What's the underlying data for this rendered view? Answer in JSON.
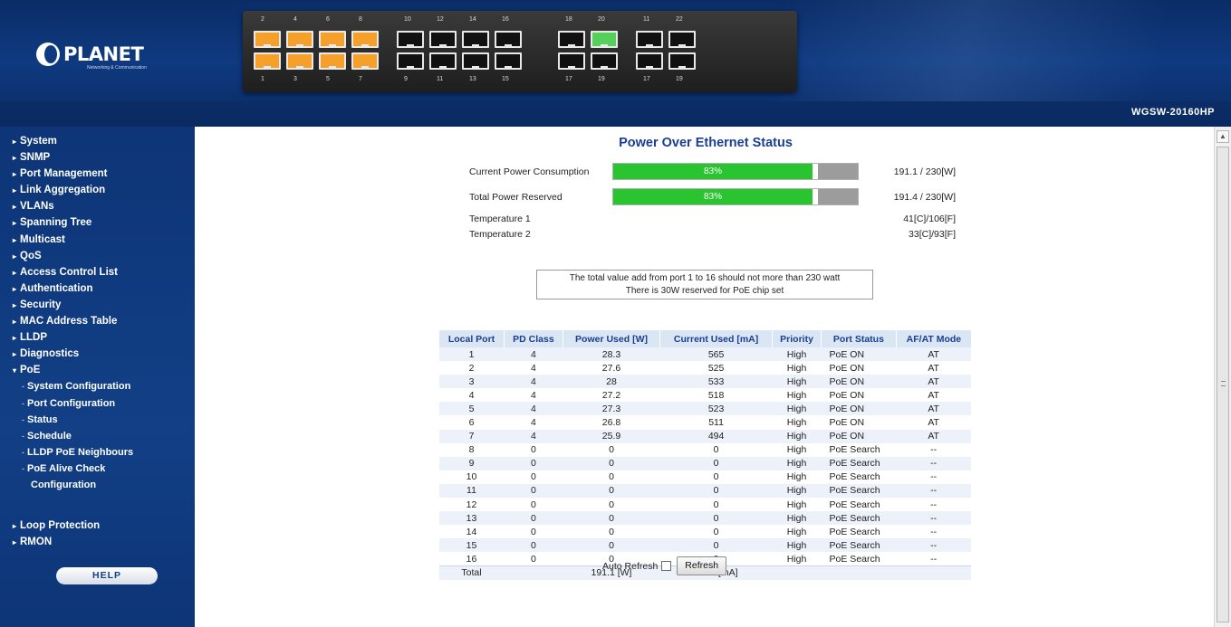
{
  "header": {
    "logo_text": "PLANET",
    "logo_subtext": "Networking & Communication",
    "model": "WGSW-20160HP"
  },
  "device": {
    "top_ports": [
      "2",
      "4",
      "6",
      "8",
      "10",
      "12",
      "14",
      "16",
      "18",
      "20",
      "11",
      "22"
    ],
    "bottom_ports": [
      "1",
      "3",
      "5",
      "7",
      "9",
      "11",
      "13",
      "15",
      "17",
      "19",
      "17",
      "19"
    ]
  },
  "sidebar": {
    "items": [
      {
        "label": "System"
      },
      {
        "label": "SNMP"
      },
      {
        "label": "Port Management"
      },
      {
        "label": "Link Aggregation"
      },
      {
        "label": "VLANs"
      },
      {
        "label": "Spanning Tree"
      },
      {
        "label": "Multicast"
      },
      {
        "label": "QoS"
      },
      {
        "label": "Access Control List"
      },
      {
        "label": "Authentication"
      },
      {
        "label": "Security"
      },
      {
        "label": "MAC Address Table"
      },
      {
        "label": "LLDP"
      },
      {
        "label": "Diagnostics"
      },
      {
        "label": "PoE"
      }
    ],
    "poe_sub": [
      {
        "label": "System Configuration"
      },
      {
        "label": "Port Configuration"
      },
      {
        "label": "Status"
      },
      {
        "label": "Schedule"
      },
      {
        "label": "LLDP PoE Neighbours"
      },
      {
        "label": "PoE Alive Check"
      }
    ],
    "poe_sub_cont": "Configuration",
    "lower_items": [
      {
        "label": "Loop Protection"
      },
      {
        "label": "RMON"
      }
    ],
    "help_label": "HELP"
  },
  "main": {
    "title": "Power Over Ethernet Status",
    "current_power": {
      "label": "Current Power Consumption",
      "percent_text": "83%",
      "fraction": 0.83,
      "value": "191.1 / 230[W]"
    },
    "total_reserved": {
      "label": "Total Power Reserved",
      "percent_text": "83%",
      "fraction": 0.83,
      "value": "191.4 / 230[W]"
    },
    "temp1": {
      "label": "Temperature 1",
      "value": "41[C]/106[F]"
    },
    "temp2": {
      "label": "Temperature 2",
      "value": "33[C]/93[F]"
    },
    "note_line1": "The total value add from port 1 to 16 should not more than 230 watt",
    "note_line2": "There is 30W reserved for PoE chip set",
    "table": {
      "headers": [
        "Local Port",
        "PD Class",
        "Power Used [W]",
        "Current Used [mA]",
        "Priority",
        "Port Status",
        "AF/AT Mode"
      ],
      "rows": [
        [
          "1",
          "4",
          "28.3",
          "565",
          "High",
          "PoE ON",
          "AT"
        ],
        [
          "2",
          "4",
          "27.6",
          "525",
          "High",
          "PoE ON",
          "AT"
        ],
        [
          "3",
          "4",
          "28",
          "533",
          "High",
          "PoE ON",
          "AT"
        ],
        [
          "4",
          "4",
          "27.2",
          "518",
          "High",
          "PoE ON",
          "AT"
        ],
        [
          "5",
          "4",
          "27.3",
          "523",
          "High",
          "PoE ON",
          "AT"
        ],
        [
          "6",
          "4",
          "26.8",
          "511",
          "High",
          "PoE ON",
          "AT"
        ],
        [
          "7",
          "4",
          "25.9",
          "494",
          "High",
          "PoE ON",
          "AT"
        ],
        [
          "8",
          "0",
          "0",
          "0",
          "High",
          "PoE Search",
          "--"
        ],
        [
          "9",
          "0",
          "0",
          "0",
          "High",
          "PoE Search",
          "--"
        ],
        [
          "10",
          "0",
          "0",
          "0",
          "High",
          "PoE Search",
          "--"
        ],
        [
          "11",
          "0",
          "0",
          "0",
          "High",
          "PoE Search",
          "--"
        ],
        [
          "12",
          "0",
          "0",
          "0",
          "High",
          "PoE Search",
          "--"
        ],
        [
          "13",
          "0",
          "0",
          "0",
          "High",
          "PoE Search",
          "--"
        ],
        [
          "14",
          "0",
          "0",
          "0",
          "High",
          "PoE Search",
          "--"
        ],
        [
          "15",
          "0",
          "0",
          "0",
          "High",
          "PoE Search",
          "--"
        ],
        [
          "16",
          "0",
          "0",
          "0",
          "High",
          "PoE Search",
          "--"
        ]
      ],
      "total": {
        "label": "Total",
        "power": "191.1 [W]",
        "current": "3660 [mA]"
      }
    },
    "auto_refresh_label": "Auto Refresh",
    "refresh_button": "Refresh"
  },
  "colors": {
    "header_blue": "#0f3a80",
    "title_blue": "#1b3f8f",
    "bar_green": "#29c42f",
    "port_orange": "#f4a02a",
    "port_link_green": "#55d05a"
  }
}
